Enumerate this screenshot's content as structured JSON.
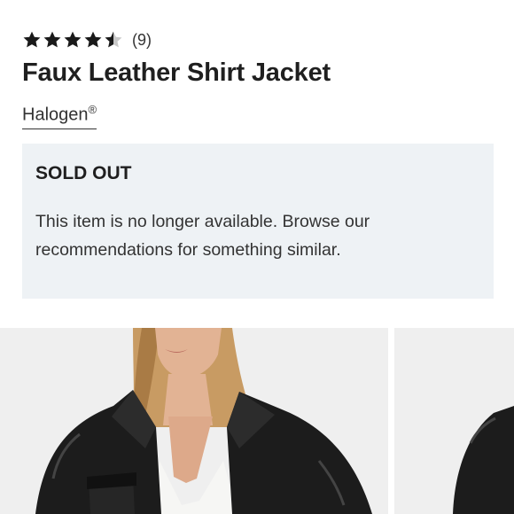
{
  "product": {
    "rating": {
      "value": 4.5,
      "max": 5,
      "count_label": "(9)",
      "star_color": "#1a1a1a",
      "empty_star_color": "#c8c8c8"
    },
    "title": "Faux Leather Shirt Jacket",
    "brand": {
      "name": "Halogen",
      "trademark": "®"
    }
  },
  "availability": {
    "heading": "SOLD OUT",
    "message": "This item is no longer available. Browse our recommendations for something similar.",
    "background_color": "#eef2f5"
  },
  "gallery": {
    "images": [
      {
        "subject": "model-wearing-black-faux-leather-jacket-front"
      },
      {
        "subject": "model-wearing-black-faux-leather-jacket-side"
      }
    ]
  }
}
